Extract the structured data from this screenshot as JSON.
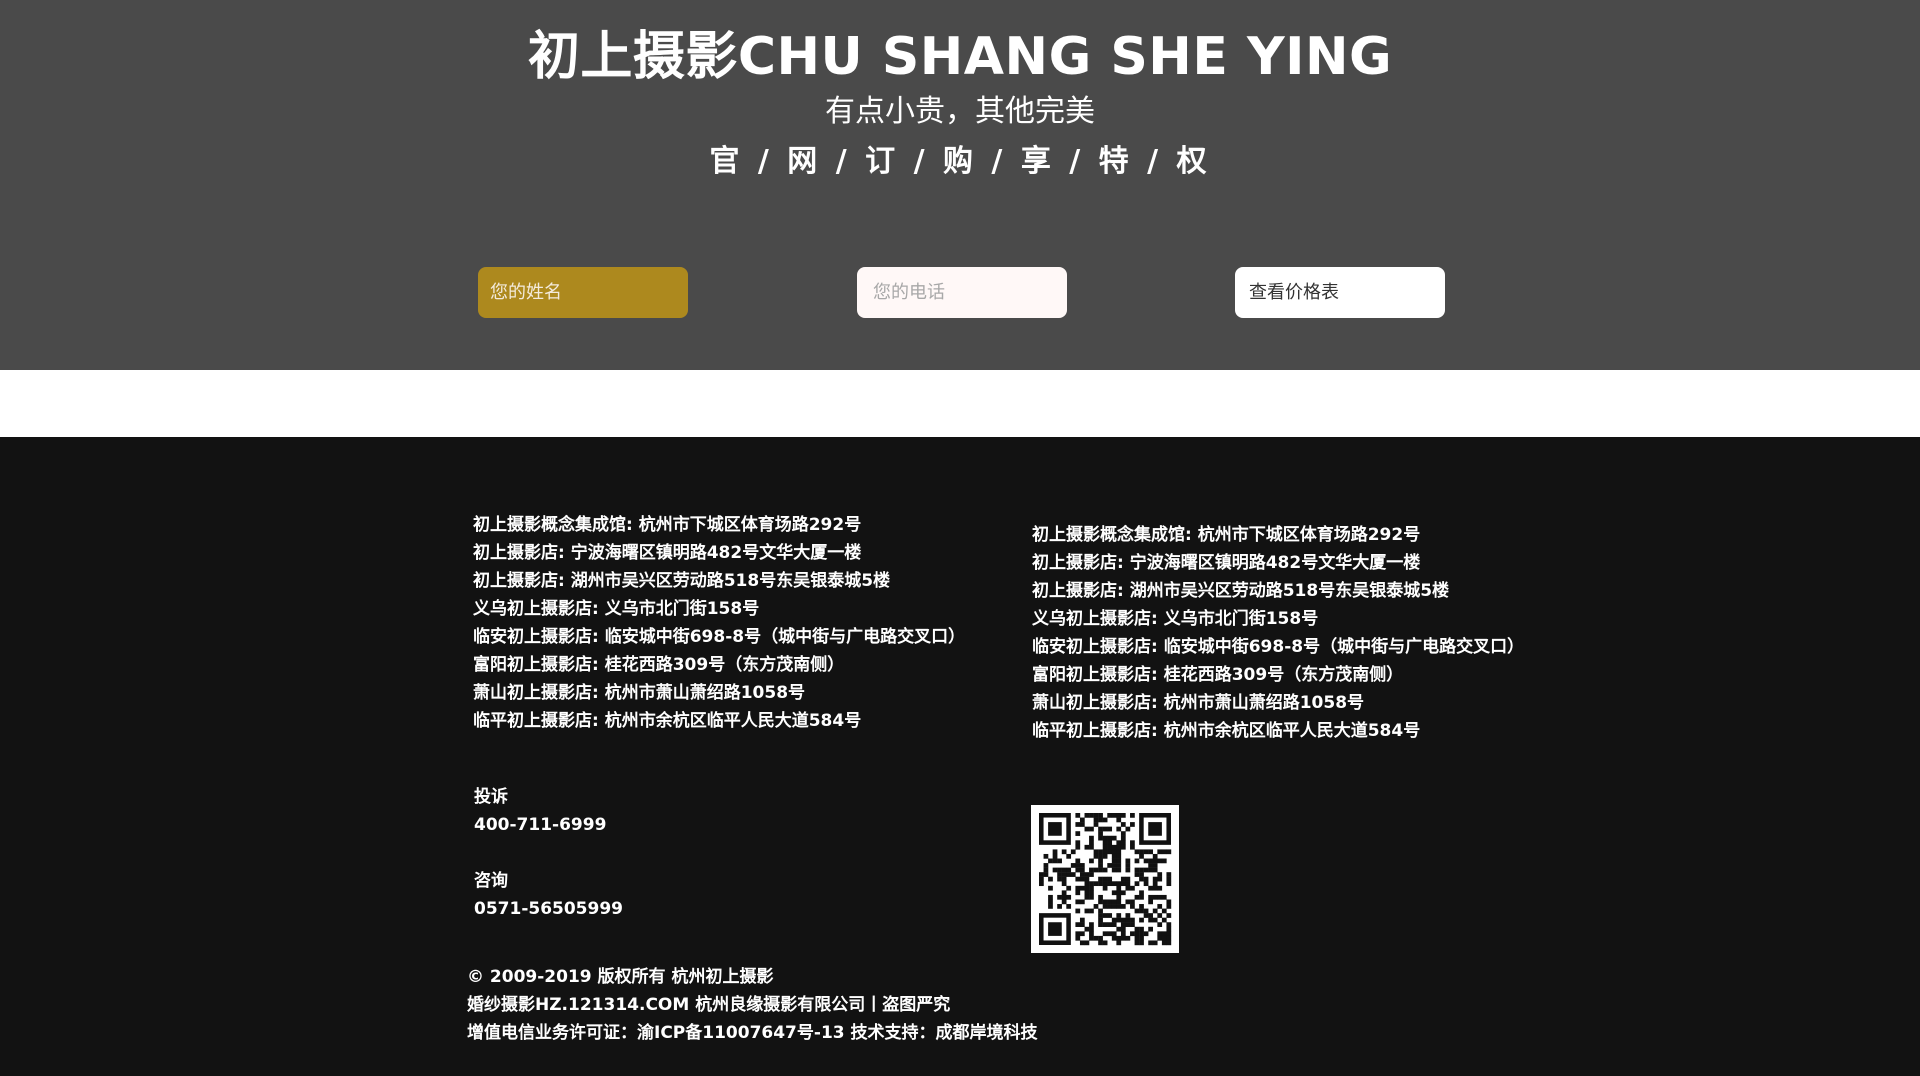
{
  "hero": {
    "title": "初上摄影CHU SHANG SHE YING",
    "slogan": "有点小贵，其他完美",
    "privilege": "官 / 网 / 订 / 购 / 享 / 特 / 权"
  },
  "form": {
    "name_placeholder": "您的姓名",
    "phone_placeholder": "您的电话",
    "price_button_label": "查看价格表",
    "name_field_color": "#ad891e"
  },
  "footer": {
    "addresses_left": [
      "初上摄影概念集成馆: 杭州市下城区体育场路292号",
      "初上摄影店: 宁波海曙区镇明路482号文华大厦一楼",
      "初上摄影店: 湖州市吴兴区劳动路518号东吴银泰城5楼",
      "义乌初上摄影店: 义乌市北门街158号",
      "临安初上摄影店: 临安城中街698-8号（城中街与广电路交叉口）",
      "富阳初上摄影店: 桂花西路309号（东方茂南侧）",
      "萧山初上摄影店: 杭州市萧山萧绍路1058号",
      "临平初上摄影店: 杭州市余杭区临平人民大道584号"
    ],
    "addresses_right": [
      "初上摄影概念集成馆: 杭州市下城区体育场路292号",
      "初上摄影店: 宁波海曙区镇明路482号文华大厦一楼",
      "初上摄影店: 湖州市吴兴区劳动路518号东吴银泰城5楼",
      "义乌初上摄影店: 义乌市北门街158号",
      "临安初上摄影店: 临安城中街698-8号（城中街与广电路交叉口）",
      "富阳初上摄影店: 桂花西路309号（东方茂南侧）",
      "萧山初上摄影店: 杭州市萧山萧绍路1058号",
      "临平初上摄影店: 杭州市余杭区临平人民大道584号"
    ],
    "complaint_label": "投诉",
    "complaint_phone": "400-711-6999",
    "consult_label": "咨询",
    "consult_phone": "0571-56505999",
    "copyright_lines": [
      "© 2009-2019 版权所有 杭州初上摄影",
      "婚纱摄影HZ.121314.COM 杭州良缘摄影有限公司丨盗图严究",
      "增值电信业务许可证：渝ICP备11007647号-13   技术支持：成都岸境科技"
    ],
    "qr_icon": "qr-code-icon"
  }
}
